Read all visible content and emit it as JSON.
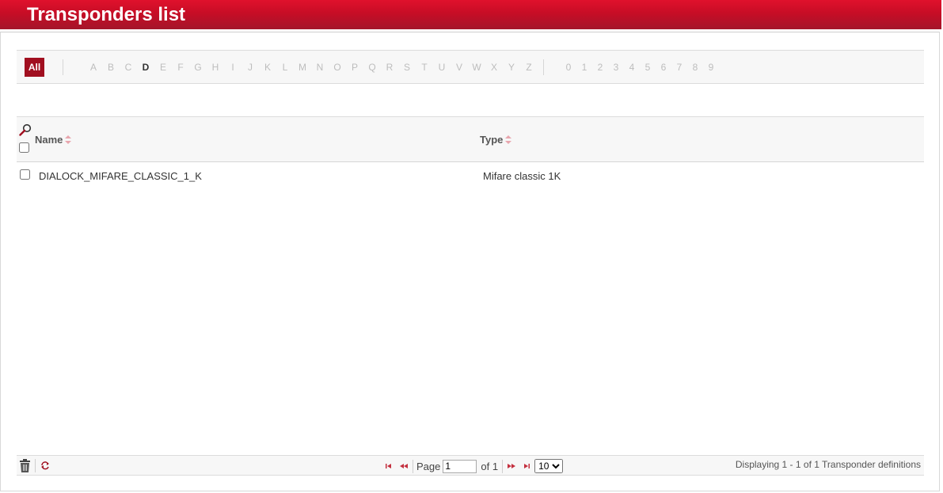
{
  "page": {
    "title": "Transponders list"
  },
  "alpha_filter": {
    "all_label": "All",
    "letters": [
      "A",
      "B",
      "C",
      "D",
      "E",
      "F",
      "G",
      "H",
      "I",
      "J",
      "K",
      "L",
      "M",
      "N",
      "O",
      "P",
      "Q",
      "R",
      "S",
      "T",
      "U",
      "V",
      "W",
      "X",
      "Y",
      "Z"
    ],
    "active_letter": "D",
    "digits": [
      "0",
      "1",
      "2",
      "3",
      "4",
      "5",
      "6",
      "7",
      "8",
      "9"
    ]
  },
  "table": {
    "columns": {
      "name": "Name",
      "type": "Type"
    },
    "rows": [
      {
        "name": "DIALOCK_MIFARE_CLASSIC_1_K",
        "type": "Mifare classic 1K"
      }
    ]
  },
  "footer": {
    "page_label": "Page",
    "page_value": "1",
    "of_label": "of 1",
    "page_size": "10",
    "display_text": "Displaying 1 - 1 of 1 Transponder definitions"
  },
  "colors": {
    "brand_red": "#c70d26",
    "all_button": "#a10f20"
  },
  "icons": [
    "search-icon",
    "sort-icon",
    "trash-icon",
    "refresh-icon",
    "first-page-icon",
    "prev-page-icon",
    "next-page-icon",
    "last-page-icon"
  ]
}
